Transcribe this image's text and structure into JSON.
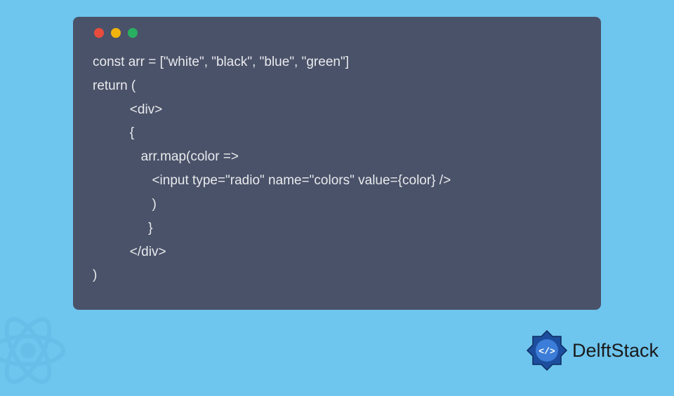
{
  "code": {
    "line1": "const arr = [\"white\", \"black\", \"blue\", \"green\"]",
    "line2": "return (",
    "line3": "          <div>",
    "line4": "          {",
    "line5": "             arr.map(color =>",
    "line6": "                <input type=\"radio\" name=\"colors\" value={color} />",
    "line7": "                )",
    "line8": "               }",
    "line9": "          </div>",
    "line10": ")"
  },
  "brand": {
    "name": "DelftStack"
  }
}
